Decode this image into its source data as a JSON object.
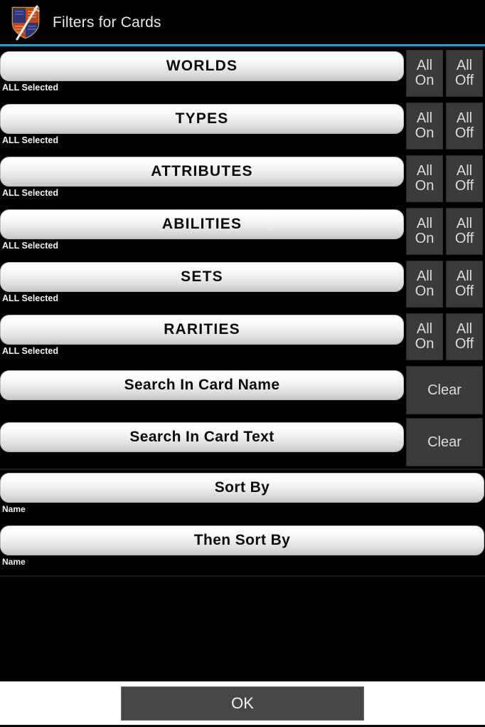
{
  "window": {
    "title": "Filters for Cards",
    "icon": "shield-sword-icon",
    "accent_color": "#2e9fc4",
    "background_color": "#000000"
  },
  "filters": [
    {
      "label": "WORLDS",
      "status": "ALL Selected",
      "all_on": "All\nOn",
      "all_on_line1": "All",
      "all_on_line2": "On",
      "all_off_line1": "All",
      "all_off_line2": "Off"
    },
    {
      "label": "TYPES",
      "status": "ALL Selected",
      "all_on_line1": "All",
      "all_on_line2": "On",
      "all_off_line1": "All",
      "all_off_line2": "Off"
    },
    {
      "label": "ATTRIBUTES",
      "status": "ALL Selected",
      "all_on_line1": "All",
      "all_on_line2": "On",
      "all_off_line1": "All",
      "all_off_line2": "Off"
    },
    {
      "label": "ABILITIES",
      "status": "ALL Selected",
      "all_on_line1": "All",
      "all_on_line2": "On",
      "all_off_line1": "All",
      "all_off_line2": "Off"
    },
    {
      "label": "SETS",
      "status": "ALL Selected",
      "all_on_line1": "All",
      "all_on_line2": "On",
      "all_off_line1": "All",
      "all_off_line2": "Off"
    },
    {
      "label": "RARITIES",
      "status": "ALL Selected",
      "all_on_line1": "All",
      "all_on_line2": "On",
      "all_off_line1": "All",
      "all_off_line2": "Off"
    }
  ],
  "searches": [
    {
      "label": "Search In Card Name",
      "value": "",
      "clear_label": "Clear"
    },
    {
      "label": "Search In Card Text",
      "value": "",
      "clear_label": "Clear"
    }
  ],
  "sorts": [
    {
      "label": "Sort By",
      "value": "Name"
    },
    {
      "label": "Then Sort By",
      "value": "Name"
    }
  ],
  "footer": {
    "ok_label": "OK"
  }
}
